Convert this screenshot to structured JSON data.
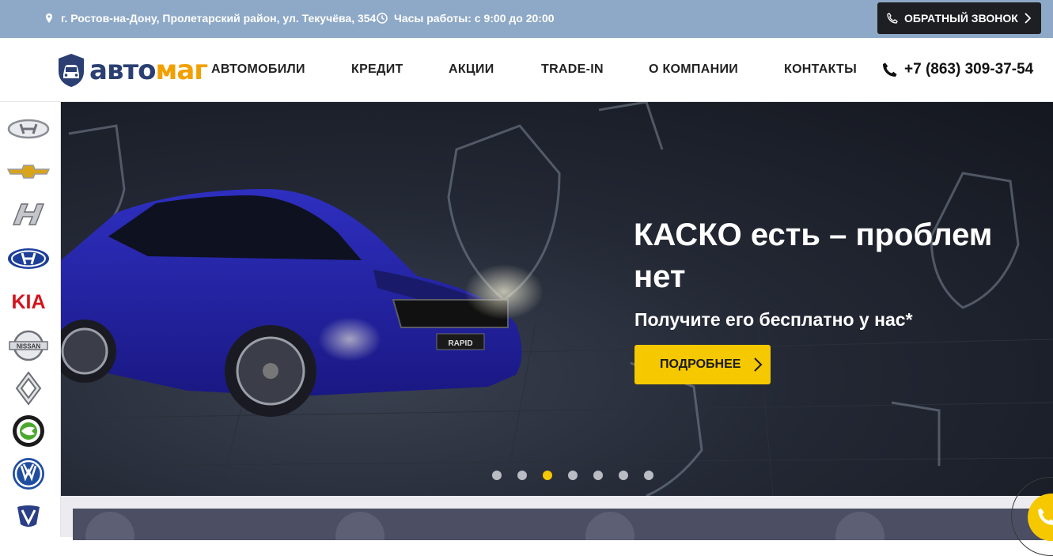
{
  "topbar": {
    "address": "г. Ростов-на-Дону, Пролетарский район, ул. Текучёва, 354",
    "hours": "Часы работы: с 9:00 до 20:00",
    "callback_label": "ОБРАТНЫЙ ЗВОНОК"
  },
  "header": {
    "logo_part1": "авто",
    "logo_part2": "маг",
    "nav": [
      "АВТОМОБИЛИ",
      "КРЕДИТ",
      "АКЦИИ",
      "TRADE-IN",
      "О КОМПАНИИ",
      "КОНТАКТЫ"
    ],
    "phone": "+7 (863) 309-37-54"
  },
  "brands": {
    "items": [
      "Hyundai",
      "Chevrolet",
      "Haval",
      "Hyundai",
      "KIA",
      "Nissan",
      "Renault",
      "Skoda",
      "Volkswagen",
      "Venucia"
    ],
    "kia_text": "KIA",
    "nissan_text": "NISSAN"
  },
  "hero": {
    "title": "КАСКО есть – проблем нет",
    "subtitle": "Получите его бесплатно у нас*",
    "button_label": "ПОДРОБНЕЕ",
    "slide_count": 7,
    "active_slide": 3,
    "car_plate": "RAPID"
  },
  "colors": {
    "topbar": "#8ea9c7",
    "accent": "#f6c800",
    "dark": "#1e1f22",
    "logo_blue": "#2b3f73",
    "logo_orange": "#f2a000"
  }
}
